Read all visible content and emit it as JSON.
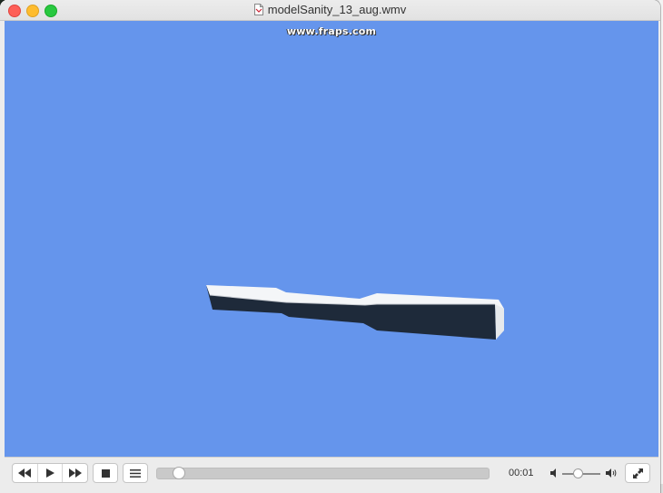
{
  "window": {
    "title": "modelSanity_13_aug.wmv"
  },
  "video": {
    "watermark": "www.fraps.com",
    "background_color": "#6595ec"
  },
  "controls": {
    "rewind_icon": "rewind-icon",
    "play_icon": "play-icon",
    "forward_icon": "fast-forward-icon",
    "stop_icon": "stop-icon",
    "playlist_icon": "playlist-icon",
    "time": "00:01",
    "playback_progress": 0.05,
    "volume_level": 0.45,
    "volume_low_icon": "volume-low-icon",
    "volume_high_icon": "volume-high-icon",
    "fullscreen_icon": "fullscreen-icon"
  }
}
